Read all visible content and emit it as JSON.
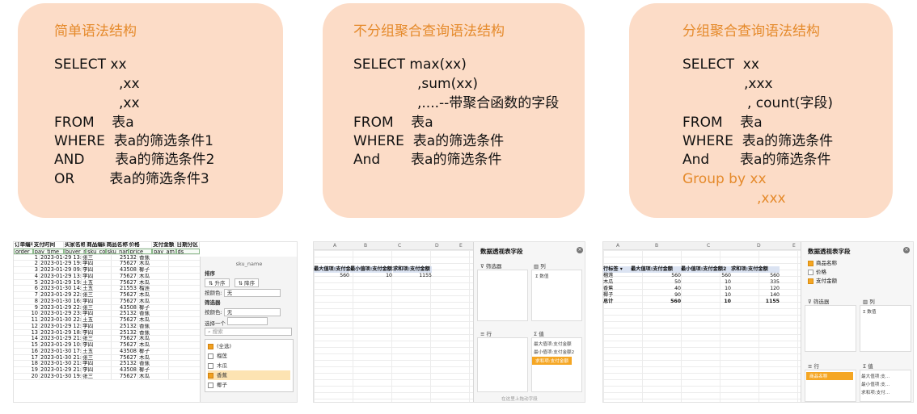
{
  "cards": [
    {
      "title": "简单语法结构",
      "lines": [
        "SELECT xx",
        ",xx",
        ",xx",
        "FROM    表a",
        "WHERE  表a的筛选条件1",
        "AND       表a的筛选条件2",
        "OR        表a的筛选条件3"
      ]
    },
    {
      "title": "不分组聚合查询语法结构",
      "lines": [
        "SELECT max(xx)",
        ",sum(xx)",
        ",....--带聚合函数的字段",
        "FROM    表a",
        "WHERE  表a的筛选条件",
        "And       表a的筛选条件"
      ]
    },
    {
      "title": "分组聚合查询语法结构",
      "lines": [
        "SELECT  xx",
        ",xxx",
        ", count(字段)",
        "FROM    表a",
        "WHERE  表a的筛选条件",
        "And       表a的筛选条件",
        "Group by xx",
        ",xxx"
      ]
    }
  ],
  "sheet": {
    "header_cn": [
      "订单编号",
      "支付时间",
      "买家名称",
      "商品编码",
      "商品名称",
      "价格",
      "支付金额",
      "日期分区"
    ],
    "header_en": [
      "order_id",
      "pay_time",
      "buyer_nam",
      "sku_cod",
      "sku_name",
      "price",
      "pay_am",
      "ds"
    ],
    "rows": [
      [
        "1",
        "2023-01-29 13:00:19",
        "张三",
        "25132",
        "香蕉"
      ],
      [
        "2",
        "2023-01-29 19:48:28",
        "李四",
        "75627",
        "木瓜"
      ],
      [
        "3",
        "2023-01-29 09:36:30",
        "李四",
        "43508",
        "椰子"
      ],
      [
        "4",
        "2023-01-29 13:14:33",
        "李四",
        "75627",
        "木瓜"
      ],
      [
        "5",
        "2023-01-29 19:18:23",
        "王五",
        "75627",
        "木瓜"
      ],
      [
        "6",
        "2023-01-30 14:31:03",
        "王五",
        "21553",
        "榴莲"
      ],
      [
        "7",
        "2023-01-29 22:43:47",
        "张三",
        "75627",
        "木瓜"
      ],
      [
        "8",
        "2023-01-30 16:11:47",
        "李四",
        "75627",
        "木瓜"
      ],
      [
        "9",
        "2023-01-29 22:38:56",
        "张三",
        "43508",
        "椰子"
      ],
      [
        "10",
        "2023-01-29 23:00:45",
        "李四",
        "25132",
        "香蕉"
      ],
      [
        "11",
        "2023-01-30 22:02:09",
        "王五",
        "75627",
        "木瓜"
      ],
      [
        "12",
        "2023-01-29 12:37:03",
        "李四",
        "25132",
        "香蕉"
      ],
      [
        "13",
        "2023-01-29 18:15:20",
        "李四",
        "25132",
        "香蕉"
      ],
      [
        "14",
        "2023-01-29 21:34:52",
        "张三",
        "75627",
        "木瓜"
      ],
      [
        "15",
        "2023-01-29 10:31:36",
        "李四",
        "75627",
        "木瓜"
      ],
      [
        "16",
        "2023-01-30 17:19:10",
        "王五",
        "43508",
        "椰子"
      ],
      [
        "17",
        "2023-01-30 21:19:14",
        "张三",
        "75627",
        "木瓜"
      ],
      [
        "18",
        "2023-01-30 21:29:29",
        "李四",
        "25132",
        "香蕉"
      ],
      [
        "19",
        "2023-01-29 21:04:41",
        "李四",
        "43508",
        "椰子"
      ],
      [
        "20",
        "2023-01-30 19:24:45",
        "张三",
        "75627",
        "木瓜"
      ]
    ]
  },
  "filter_panel": {
    "field": "sku_name",
    "sort_label": "排序",
    "asc": "升序",
    "desc": "降序",
    "by_color_label": "按颜色:",
    "none": "无",
    "filter_label": "筛选器",
    "choose_one": "选择一个",
    "search_placeholder": "搜索",
    "items": [
      "(全选)",
      "榴莲",
      "木瓜",
      "香蕉",
      "椰子"
    ]
  },
  "pivot1": {
    "cols": [
      "A",
      "B",
      "C",
      "D",
      "E"
    ],
    "headers": [
      "最大值项:支付金额",
      "最小值项:支付金额2",
      "求和项:支付金额"
    ],
    "values": [
      "560",
      "10",
      "1155"
    ],
    "panel_title": "数据透视表字段",
    "filter_zone": "筛选器",
    "col_zone": "列",
    "col_value": "Σ 数值",
    "row_zone": "行",
    "value_zone": "值",
    "value_items": [
      "最大值项:支付金额",
      "最小值项:支付金额2",
      "求和项:支付金额"
    ],
    "footer": "在这里上拖动字段"
  },
  "pivot2": {
    "cols": [
      "A",
      "B",
      "C",
      "D",
      "E"
    ],
    "row_header": "行标签",
    "headers": [
      "最大值项:支付金额",
      "最小值项:支付金额2",
      "求和项:支付金额"
    ],
    "rows": [
      [
        "榴莲",
        "560",
        "560",
        "560"
      ],
      [
        "木瓜",
        "50",
        "10",
        "335"
      ],
      [
        "香蕉",
        "40",
        "10",
        "120"
      ],
      [
        "椰子",
        "90",
        "10",
        "140"
      ]
    ],
    "total": [
      "总计",
      "560",
      "10",
      "1155"
    ],
    "panel_title": "数据透视表字段",
    "fields": [
      {
        "label": "商品名称",
        "checked": true
      },
      {
        "label": "价格",
        "checked": false
      },
      {
        "label": "支付金额",
        "checked": true
      }
    ],
    "filter_zone": "筛选器",
    "col_zone": "列",
    "col_value": "Σ 数值",
    "row_zone": "行",
    "row_item": "商品名称",
    "value_zone": "值",
    "value_items": [
      "最大值项:支...",
      "最小值项:支...",
      "求和项:支付..."
    ]
  }
}
